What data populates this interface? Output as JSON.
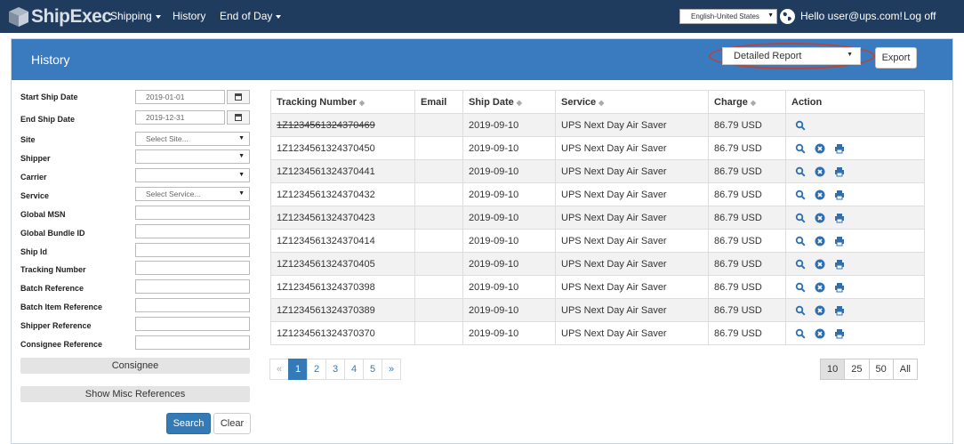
{
  "nav": {
    "brand": "ShipExec",
    "shipping": "Shipping",
    "history": "History",
    "end_of_day": "End of Day",
    "language": "English-United States",
    "greeting": "Hello user@ups.com!",
    "logoff": "Log off"
  },
  "panel": {
    "title": "History",
    "report_type": "Detailed Report",
    "export": "Export"
  },
  "filters": {
    "start_ship_date": {
      "label": "Start Ship Date",
      "value": "2019-01-01"
    },
    "end_ship_date": {
      "label": "End Ship Date",
      "value": "2019-12-31"
    },
    "site": {
      "label": "Site",
      "value": "Select Site..."
    },
    "shipper": {
      "label": "Shipper",
      "value": ""
    },
    "carrier": {
      "label": "Carrier",
      "value": ""
    },
    "service": {
      "label": "Service",
      "value": "Select Service..."
    },
    "global_msn": {
      "label": "Global MSN",
      "value": ""
    },
    "global_bundle_id": {
      "label": "Global Bundle ID",
      "value": ""
    },
    "ship_id": {
      "label": "Ship Id",
      "value": ""
    },
    "tracking_number": {
      "label": "Tracking Number",
      "value": ""
    },
    "batch_reference": {
      "label": "Batch Reference",
      "value": ""
    },
    "batch_item_reference": {
      "label": "Batch Item Reference",
      "value": ""
    },
    "shipper_reference": {
      "label": "Shipper Reference",
      "value": ""
    },
    "consignee_reference": {
      "label": "Consignee Reference",
      "value": ""
    },
    "consignee_button": "Consignee",
    "misc_button": "Show Misc References",
    "search_button": "Search",
    "clear_button": "Clear"
  },
  "table": {
    "headers": {
      "tracking": "Tracking Number",
      "email": "Email",
      "ship_date": "Ship Date",
      "service": "Service",
      "charge": "Charge",
      "action": "Action"
    },
    "rows": [
      {
        "tracking": "1Z1234561324370469",
        "email": "",
        "ship_date": "2019-09-10",
        "service": "UPS Next Day Air Saver",
        "charge": "86.79 USD",
        "voided": true
      },
      {
        "tracking": "1Z1234561324370450",
        "email": "",
        "ship_date": "2019-09-10",
        "service": "UPS Next Day Air Saver",
        "charge": "86.79 USD",
        "voided": false
      },
      {
        "tracking": "1Z1234561324370441",
        "email": "",
        "ship_date": "2019-09-10",
        "service": "UPS Next Day Air Saver",
        "charge": "86.79 USD",
        "voided": false
      },
      {
        "tracking": "1Z1234561324370432",
        "email": "",
        "ship_date": "2019-09-10",
        "service": "UPS Next Day Air Saver",
        "charge": "86.79 USD",
        "voided": false
      },
      {
        "tracking": "1Z1234561324370423",
        "email": "",
        "ship_date": "2019-09-10",
        "service": "UPS Next Day Air Saver",
        "charge": "86.79 USD",
        "voided": false
      },
      {
        "tracking": "1Z1234561324370414",
        "email": "",
        "ship_date": "2019-09-10",
        "service": "UPS Next Day Air Saver",
        "charge": "86.79 USD",
        "voided": false
      },
      {
        "tracking": "1Z1234561324370405",
        "email": "",
        "ship_date": "2019-09-10",
        "service": "UPS Next Day Air Saver",
        "charge": "86.79 USD",
        "voided": false
      },
      {
        "tracking": "1Z1234561324370398",
        "email": "",
        "ship_date": "2019-09-10",
        "service": "UPS Next Day Air Saver",
        "charge": "86.79 USD",
        "voided": false
      },
      {
        "tracking": "1Z1234561324370389",
        "email": "",
        "ship_date": "2019-09-10",
        "service": "UPS Next Day Air Saver",
        "charge": "86.79 USD",
        "voided": false
      },
      {
        "tracking": "1Z1234561324370370",
        "email": "",
        "ship_date": "2019-09-10",
        "service": "UPS Next Day Air Saver",
        "charge": "86.79 USD",
        "voided": false
      }
    ]
  },
  "pagination": {
    "prev": "«",
    "pages": [
      "1",
      "2",
      "3",
      "4",
      "5"
    ],
    "next": "»",
    "current_page": "1"
  },
  "page_sizes": {
    "options": [
      "10",
      "25",
      "50",
      "All"
    ],
    "selected": "10"
  },
  "colors": {
    "navbar": "#1f3b5e",
    "panel_heading": "#3a7abf",
    "primary": "#337ab7",
    "highlight_ring": "#b7453b"
  }
}
